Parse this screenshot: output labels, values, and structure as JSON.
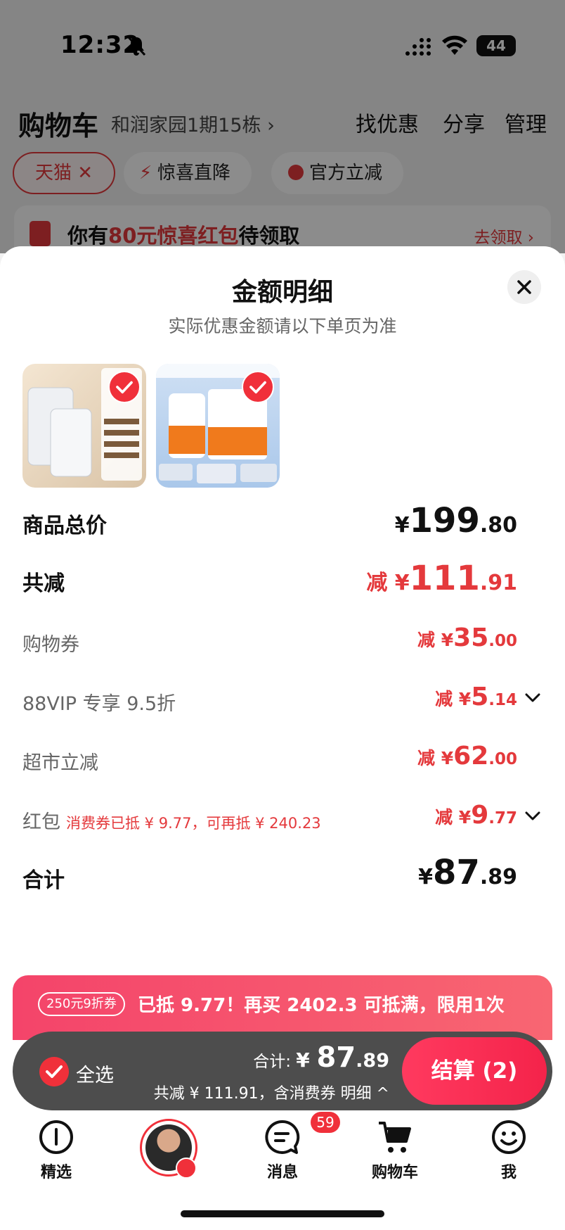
{
  "status_bar": {
    "time": "12:32",
    "battery": "44"
  },
  "header": {
    "title": "购物车",
    "address": "和润家园1期15栋 ›",
    "actions": [
      "找优惠",
      "分享",
      "管理"
    ]
  },
  "filters": [
    {
      "label": "天猫 ✕"
    },
    {
      "label": "惊喜直降"
    },
    {
      "label": "官方立减"
    }
  ],
  "red_packet_banner": {
    "text_pre": "你有",
    "text_highlight": "80元惊喜红包",
    "text_post": "待领取",
    "link": "去领取 ›"
  },
  "modal": {
    "title": "金额明细",
    "subtitle": "实际优惠金额请以下单页为准",
    "rows": [
      {
        "label": "商品总价",
        "prefix": "¥",
        "int": "199",
        "dec": ".80"
      },
      {
        "label": "共减",
        "prefix": "减 ¥",
        "int": "111",
        "dec": ".91"
      },
      {
        "label": "购物券",
        "prefix": "减 ¥",
        "int": "35",
        "dec": ".00"
      },
      {
        "label": "88VIP 专享 9.5折",
        "prefix": "减 ¥",
        "int": "5",
        "dec": ".14"
      },
      {
        "label": "超市立减",
        "prefix": "减 ¥",
        "int": "62",
        "dec": ".00"
      },
      {
        "label": "红包",
        "note": "消费券已抵 ¥ 9.77，可再抵 ¥ 240.23",
        "prefix": "减 ¥",
        "int": "9",
        "dec": ".77"
      },
      {
        "label": "合计",
        "prefix": "¥",
        "int": "87",
        "dec": ".89"
      }
    ]
  },
  "promo": {
    "badge": "250元9折券",
    "text": "已抵 9.77！再买 2402.3 可抵满，限用1次"
  },
  "checkout": {
    "select_all": "全选",
    "total_label": "合计: ",
    "total_currency": "¥ ",
    "total_int": "87",
    "total_dec": ".89",
    "savings": "共减 ¥ 111.91，含消费券  明细 ^",
    "pay_label": "结算 (2)"
  },
  "tabs": [
    {
      "label": "精选"
    },
    {
      "label": ""
    },
    {
      "label": "消息",
      "badge": "59"
    },
    {
      "label": "购物车"
    },
    {
      "label": "我"
    }
  ],
  "colors": {
    "accent": "#e4393c",
    "checkout_bar": "#4d4d4d"
  }
}
